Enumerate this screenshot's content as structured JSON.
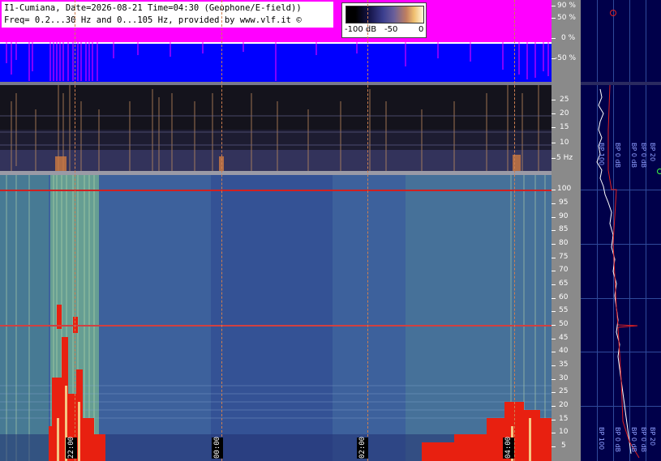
{
  "header": {
    "line1": "I1-Cumiana, Date=2026-08-21 Time=04:30 (Geophone/E-field))",
    "line2": "Freq= 0.2...30 Hz and 0...105 Hz, provided by www.vlf.it ©"
  },
  "colorbar": {
    "label_min": "-100 dB",
    "label_mid": "-50",
    "label_max": "0"
  },
  "top_axis": {
    "ticks": [
      "90 %",
      "50 %",
      "0 %",
      "-50 %"
    ]
  },
  "mid_axis": {
    "ticks": [
      "25",
      "20",
      "15",
      "10",
      "5 Hz"
    ]
  },
  "main_axis": {
    "ticks": [
      "100",
      "95",
      "90",
      "85",
      "80",
      "75",
      "70",
      "65",
      "60",
      "55",
      "50",
      "45",
      "40",
      "35",
      "30",
      "25",
      "20",
      "15",
      "10",
      "5"
    ]
  },
  "time_markers": [
    {
      "label": "22:00"
    },
    {
      "label": "00:00"
    },
    {
      "label": "02:00"
    },
    {
      "label": "04:00"
    }
  ],
  "side_panel": {
    "labels": [
      "BP 100",
      "BP 0 dB",
      "BP 0 dB",
      "BP 0 dB",
      "BP 20"
    ],
    "labels_lower": [
      "BP 100",
      "BP 0 dB",
      "BP 0 dB",
      "BP 0 dB",
      "BP 20"
    ]
  },
  "colors": {
    "top_magenta": "#ff00ff",
    "top_blue": "#0000ff",
    "spectrum_blue": "#3a5a9a",
    "alert_red": "#e02020",
    "side_navy": "#00004a"
  }
}
